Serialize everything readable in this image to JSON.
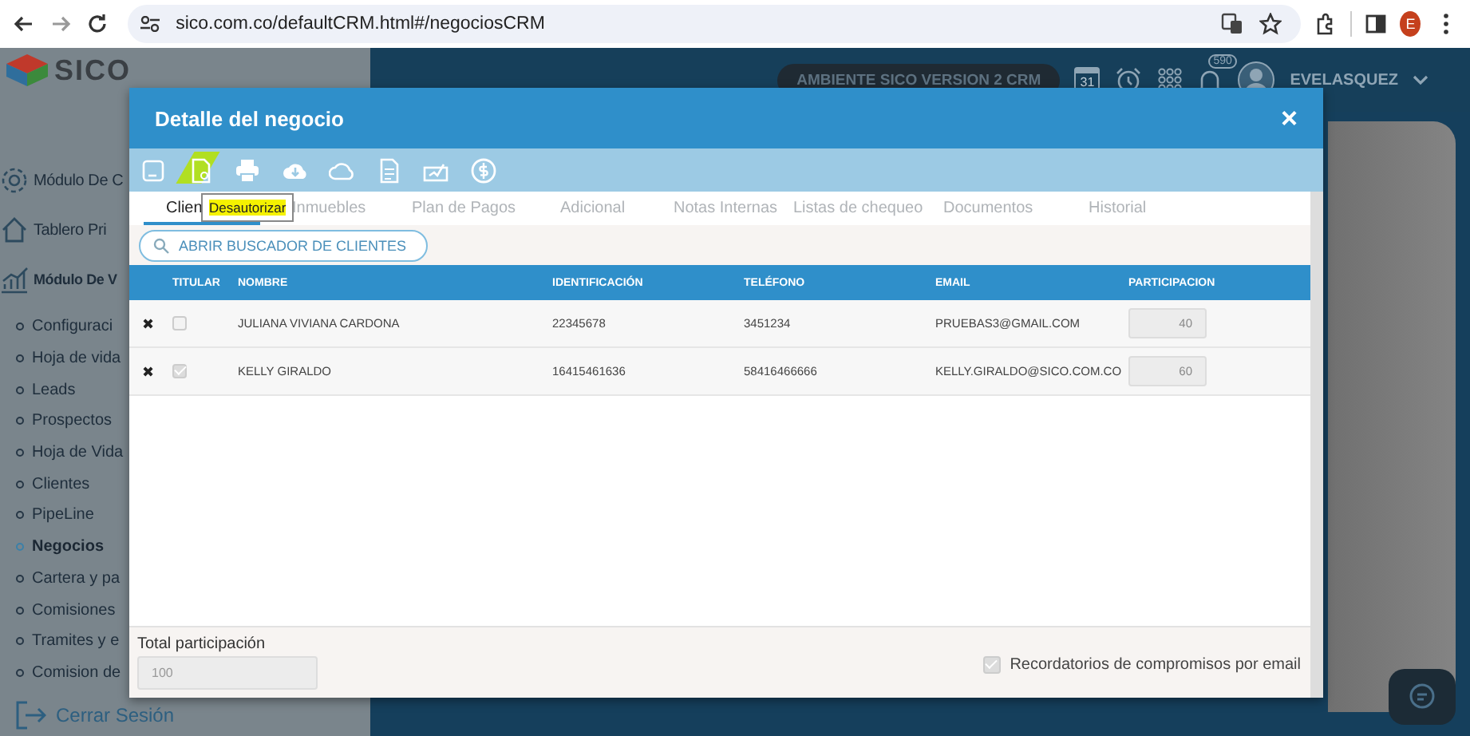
{
  "browser": {
    "url": "sico.com.co/defaultCRM.html#/negociosCRM",
    "profile_initial": "E"
  },
  "app": {
    "logo": "SICO",
    "environment": "AMBIENTE SICO VERSION 2 CRM",
    "calendar_day": "31",
    "notifications": "590",
    "user": "EVELASQUEZ"
  },
  "sidebar": {
    "sections": [
      {
        "kind": "gear",
        "label": "Módulo De C",
        "bold": false
      },
      {
        "kind": "home",
        "label": "Tablero Pri",
        "bold": false
      },
      {
        "kind": "chart",
        "label": "Módulo De V",
        "bold": true
      }
    ],
    "items": [
      {
        "label": "Configuraci",
        "selected": false
      },
      {
        "label": "Hoja de vida",
        "selected": false
      },
      {
        "label": "Leads",
        "selected": false
      },
      {
        "label": "Prospectos",
        "selected": false
      },
      {
        "label": "Hoja de Vida",
        "selected": false
      },
      {
        "label": "Clientes",
        "selected": false
      },
      {
        "label": "PipeLine",
        "selected": false
      },
      {
        "label": "Negocios",
        "selected": true
      },
      {
        "label": "Cartera y pa",
        "selected": false
      },
      {
        "label": "Comisiones",
        "selected": false
      },
      {
        "label": "Tramites y e",
        "selected": false
      },
      {
        "label": "Comision de",
        "selected": false
      }
    ],
    "logout": "Cerrar Sesión"
  },
  "modal": {
    "title": "Detalle del negocio",
    "close": "×",
    "tooltip": "Desautorizar",
    "tabs": [
      {
        "label": "Clien",
        "selected": true
      },
      {
        "label": "Inmuebles",
        "selected": false
      },
      {
        "label": "Plan de Pagos",
        "selected": false
      },
      {
        "label": "Adicional",
        "selected": false
      },
      {
        "label": "Notas Internas",
        "selected": false
      },
      {
        "label": "Listas de chequeo",
        "selected": false
      },
      {
        "label": "Documentos",
        "selected": false
      },
      {
        "label": "Historial",
        "selected": false
      }
    ],
    "search_button": "ABRIR BUSCADOR DE CLIENTES",
    "table": {
      "columns": [
        "TITULAR",
        "NOMBRE",
        "IDENTIFICACIÓN",
        "TELÉFONO",
        "EMAIL",
        "PARTICIPACION"
      ],
      "rows": [
        {
          "remove": "✖",
          "titular": false,
          "nombre": "JULIANA VIVIANA CARDONA",
          "identificacion": "22345678",
          "telefono": "3451234",
          "email": "PRUEBAS3@GMAIL.COM",
          "participacion": "40"
        },
        {
          "remove": "✖",
          "titular": true,
          "nombre": "KELLY GIRALDO",
          "identificacion": "16415461636",
          "telefono": "58416466666",
          "email": "KELLY.GIRALDO@SICO.COM.CO",
          "participacion": "60"
        }
      ]
    },
    "total_label": "Total participación",
    "total_value": "100",
    "reminders": {
      "label": "Recordatorios de compromisos por email",
      "checked": true
    }
  }
}
